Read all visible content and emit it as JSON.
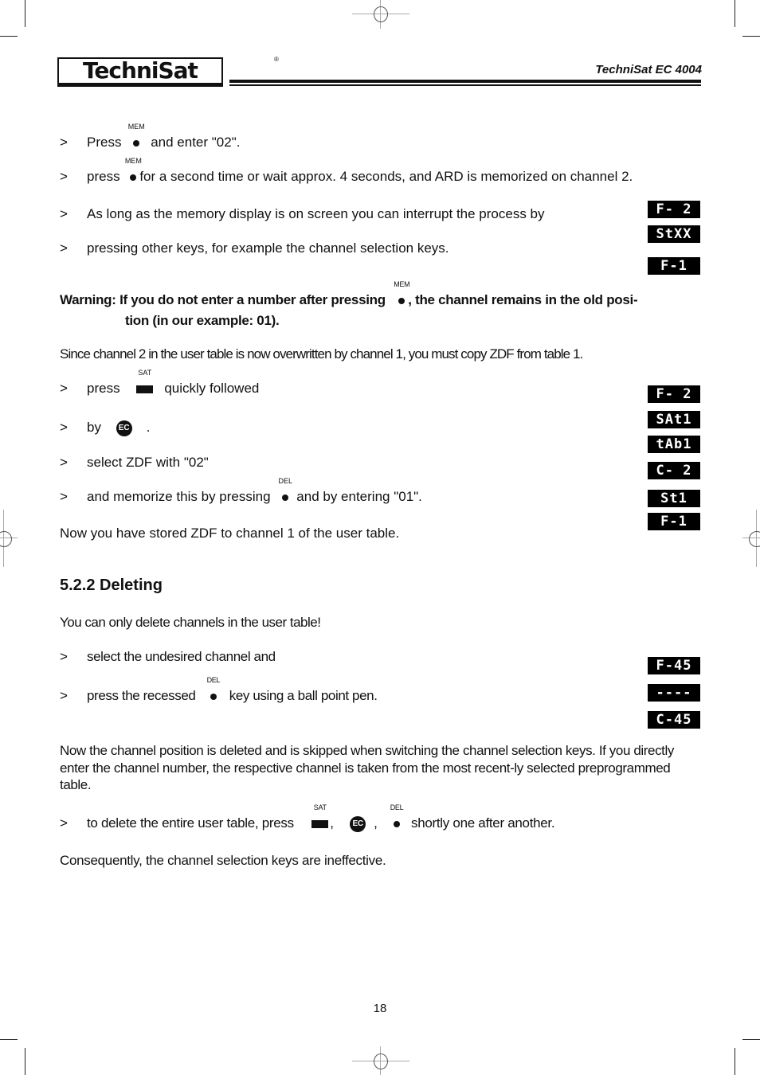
{
  "header": {
    "logo": "TechniSat",
    "logo_mark": "®",
    "doc_title": "TechniSat EC 4004"
  },
  "keys": {
    "mem": "MEM",
    "sat": "SAT",
    "del": "DEL",
    "ec": "EC"
  },
  "section1": {
    "bullet": ">",
    "step1": {
      "before": "Press",
      "after": "and enter \"02\"."
    },
    "step2": {
      "before": "press",
      "after": "for a second time or wait approx. 4 seconds, and ARD is memorized on channel 2."
    },
    "step3": "As long as the memory display is on screen you can interrupt the process by",
    "step4": "pressing other keys, for example the channel selection keys.",
    "warning": {
      "label": "Warning:",
      "before": "If you do not enter a number after pressing",
      "after": ",  the channel remains in the old posi-",
      "line2": "tion (in our example: 01)."
    },
    "note": "Since channel 2 in the user table is now overwritten by channel 1, you must copy ZDF from table 1.",
    "step5": {
      "before": "press",
      "after": "quickly followed"
    },
    "step6": {
      "before": "by",
      "after": "."
    },
    "step7": "select ZDF with \"02\"",
    "step8": {
      "before": "and memorize this by pressing",
      "after": "and by entering \"01\"."
    },
    "result": "Now you have stored ZDF to channel 1 of the user table."
  },
  "section2": {
    "heading": "5.2.2 Deleting",
    "intro": "You can only delete channels in the user table!",
    "step1": "select the undesired channel and",
    "step2": {
      "before": "press the recessed",
      "after": "key using a ball point pen."
    },
    "para": "Now the channel position is deleted and is skipped when switching the channel selection keys. If you directly enter the channel number, the respective channel is taken from the most recent-ly selected preprogrammed table.",
    "step3": {
      "before": "to delete the entire user table, press",
      "sep": ",",
      "after": "shortly one after another."
    },
    "conclusion": "Consequently, the channel selection keys are ineffective."
  },
  "displays": {
    "group1": [
      "F- 2",
      "StXX",
      "F-1"
    ],
    "group2": [
      "F- 2",
      "SAt1",
      "tAb1",
      "C- 2",
      "St1",
      "F-1"
    ],
    "group3": [
      "F-45",
      "----",
      "C-45"
    ]
  },
  "footer": {
    "page_number": "18"
  }
}
